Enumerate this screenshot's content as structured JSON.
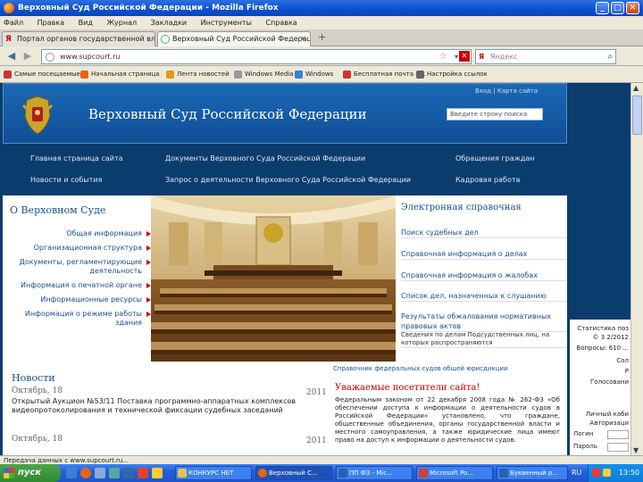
{
  "window": {
    "title": "Верховный Суд Российской Федерации - Mozilla Firefox",
    "min": "_",
    "max": "□",
    "close": "✕"
  },
  "menu": [
    "Файл",
    "Правка",
    "Вид",
    "Журнал",
    "Закладки",
    "Инструменты",
    "Справка"
  ],
  "tabs": [
    {
      "label": "Портал органов государственной власт...",
      "icon": "yandex-icon",
      "active": false
    },
    {
      "label": "Верховный Суд Российской Федерации",
      "icon": "page-icon",
      "active": true
    }
  ],
  "new_tab": "+",
  "nav": {
    "back": "◀",
    "forward": "▶",
    "url": "www.supcourt.ru",
    "search_placeholder": "Яндекс",
    "search_engine_letter": "Я"
  },
  "bookmarks": [
    {
      "label": "Самые посещаемые",
      "color": "#c33"
    },
    {
      "label": "Начальная страница",
      "color": "#e8631a"
    },
    {
      "label": "Лента новостей",
      "color": "#e39a1a"
    },
    {
      "label": "Windows Media",
      "color": "#999"
    },
    {
      "label": "Windows",
      "color": "#3a7fd5"
    },
    {
      "label": "Бесплатная почта Н...",
      "color": "#c33"
    },
    {
      "label": "Настройка ссылок",
      "color": "#666"
    }
  ],
  "header": {
    "title": "Верховный Суд Российской Федерации",
    "links": "Вход | Карта сайта",
    "search_placeholder": "Введите строку поиска",
    "search_go": "›"
  },
  "topnav": [
    [
      "Главная страница сайта",
      "Документы Верховного Суда Российской Федерации",
      "Обращения граждан"
    ],
    [
      "Новости и события",
      "Запрос о деятельности Верховного Суда Российской Федерации",
      "Кадровая работа"
    ]
  ],
  "left": {
    "title": "О Верховном Суде",
    "items": [
      "Общая информация",
      "Организационная структура",
      "Документы, регламентирующие деятельность",
      "Информация о печатной органе",
      "Информационные ресурсы",
      "Информация о режиме работы здания"
    ]
  },
  "eref": {
    "title": "Электронная справочная",
    "items": [
      "Поиск судебных дел",
      "Справочная информация о делах",
      "Справочная информация о жалобах",
      "Список дел, назначенных к слушанию",
      "Результаты обжалования нормативных правовых актов",
      "Сведения по делам Подсудственных лиц, на которых распространяются"
    ]
  },
  "news": {
    "title": "Новости",
    "items": [
      {
        "date": "Октябрь, 18",
        "year": "2011",
        "text": "Открытый Аукцион №53/11 Поставка программно-аппаратных комплексов видеопротоколирования и технической фиксации судебных заседаний"
      },
      {
        "date": "Октябрь, 18",
        "year": "2011",
        "text": ""
      }
    ]
  },
  "notice": {
    "link": "Справочник федеральных судов общей юрисдикции",
    "title": "Уважаемые посетители сайта!",
    "text": "Федеральным законом от 22 декабря 2008 года № 262-ФЗ «Об обеспечении доступа к информации о деятельности судов в Российской Федерации» установлено, что граждане, общественные объединения, органы государственной власти и местного самоуправления, а также юридические лица имеют право на доступ к информации о деятельности судов."
  },
  "rightcol": [
    "Статистика поз",
    "© 3 2/2012",
    "Вопросы: 610 ...",
    "Сол",
    "Р",
    "Голосовани",
    "Личный каби",
    "Авторизаци",
    "Логин",
    "Пароль"
  ],
  "status": "Передача данных с www.supcourt.ru...",
  "taskbar": {
    "start": "пуск",
    "buttons": [
      {
        "label": "КОНКУРС НЕТ",
        "color": "#e8c34a",
        "on": false
      },
      {
        "label": "Верховный С...",
        "color": "#e8631a",
        "on": true
      },
      {
        "label": "ПП ФЗ - Mic...",
        "color": "#2b5fb3",
        "on": false
      },
      {
        "label": "Microsoft Po...",
        "color": "#d0402a",
        "on": false
      },
      {
        "label": "Буквенный р...",
        "color": "#2b5fb3",
        "on": false
      }
    ],
    "lang": "RU",
    "clock": "13:50"
  }
}
